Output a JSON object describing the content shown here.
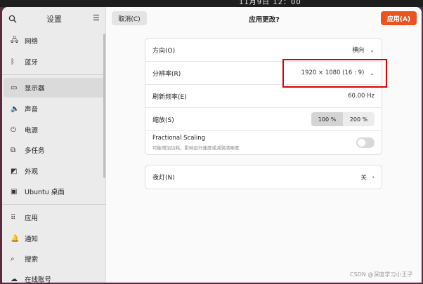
{
  "topbar": {
    "clock": "11月9日 12：00"
  },
  "sidebar": {
    "title": "设置",
    "search_icon": "search-icon",
    "menu_icon": "hamburger-icon",
    "items": [
      {
        "label": "网络",
        "icon": "network-icon"
      },
      {
        "label": "蓝牙",
        "icon": "bluetooth-icon"
      },
      {
        "label": "显示器",
        "icon": "display-icon",
        "active": true
      },
      {
        "label": "声音",
        "icon": "sound-icon"
      },
      {
        "label": "电源",
        "icon": "power-icon"
      },
      {
        "label": "多任务",
        "icon": "multitask-icon"
      },
      {
        "label": "外观",
        "icon": "appearance-icon"
      },
      {
        "label": "Ubuntu 桌面",
        "icon": "ubuntu-desktop-icon"
      },
      {
        "label": "应用",
        "icon": "apps-icon"
      },
      {
        "label": "通知",
        "icon": "notification-icon"
      },
      {
        "label": "搜索",
        "icon": "search-icon"
      },
      {
        "label": "在线账号",
        "icon": "online-accounts-icon"
      }
    ]
  },
  "header": {
    "cancel_label": "取消(C)",
    "title": "应用更改?",
    "apply_label": "应用(A)"
  },
  "display": {
    "orientation": {
      "label": "方向(O)",
      "value": "横向"
    },
    "resolution": {
      "label": "分辨率(R)",
      "value": "1920 × 1080 (16 : 9)"
    },
    "refresh": {
      "label": "刷新频率(E)",
      "value": "60.00 Hz"
    },
    "scale": {
      "label": "缩放(S)",
      "options": [
        "100 %",
        "200 %"
      ],
      "selected": "100 %"
    },
    "fractional": {
      "title": "Fractional Scaling",
      "subtitle": "可能增加功耗，影响运行速度或减弱清晰度",
      "enabled": false
    }
  },
  "night_light": {
    "label": "夜灯(N)",
    "value": "关"
  },
  "colors": {
    "accent": "#e95420",
    "highlight": "#e00000"
  },
  "watermark": "CSDN @深度学习小王子"
}
